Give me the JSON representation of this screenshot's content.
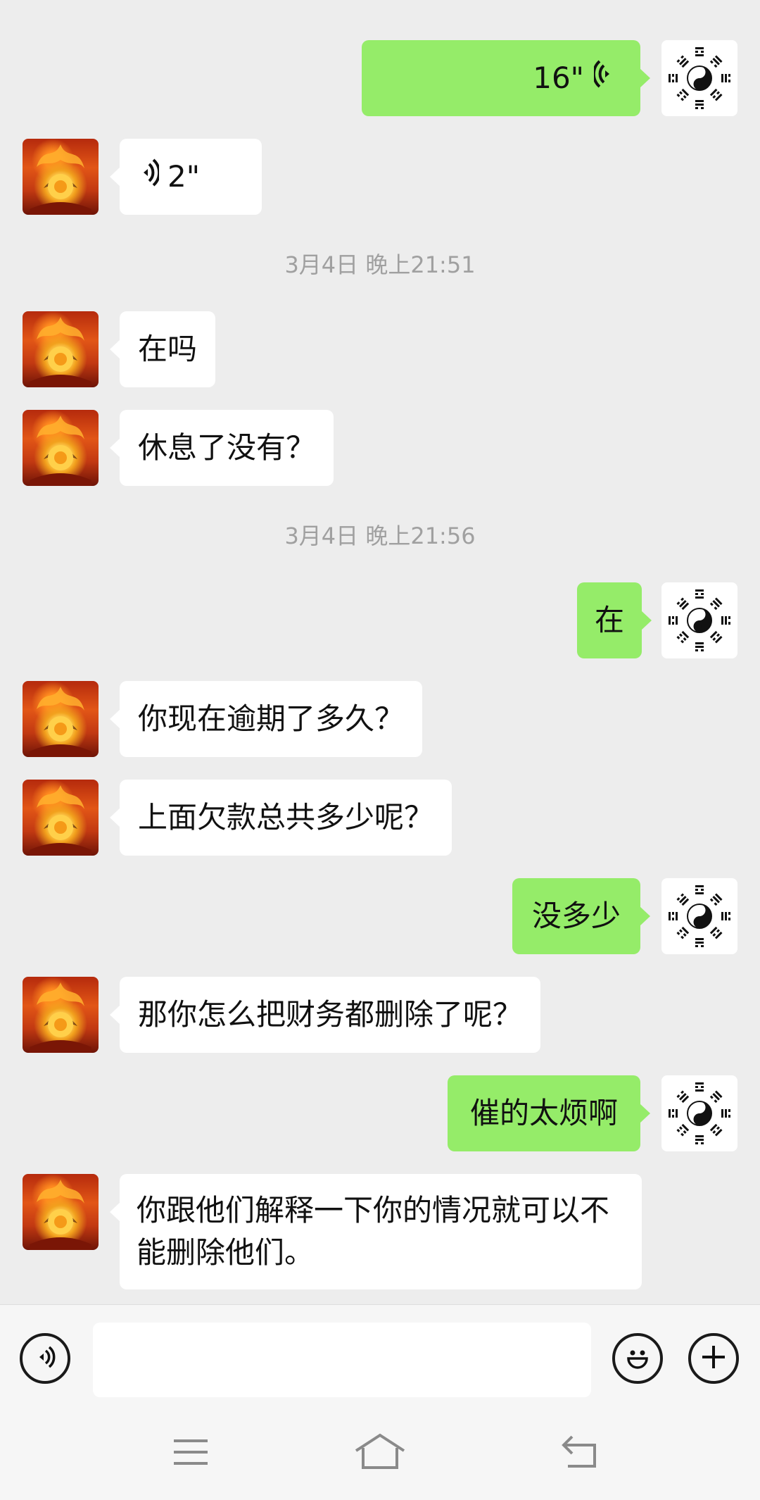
{
  "messages": {
    "m1": {
      "side": "right",
      "type": "voice",
      "duration": "16\""
    },
    "m2": {
      "side": "left",
      "type": "voice",
      "duration": "2\""
    },
    "time1": "3月4日 晚上21:51",
    "m3": "在吗",
    "m4": "休息了没有？",
    "time2": "3月4日 晚上21:56",
    "m5": "在",
    "m6": "你现在逾期了多久？",
    "m7": "上面欠款总共多少呢？",
    "m8": "没多少",
    "m9": "那你怎么把财务都删除了呢？",
    "m10": "催的太烦啊",
    "m11": "你跟他们解释一下你的情况就可以不能删除他们。"
  },
  "colors": {
    "chat_background": "#ededed",
    "sent_bubble": "#95ec69",
    "received_bubble": "#ffffff",
    "timestamp_text": "#a0a0a0"
  },
  "icons": {
    "contact_avatar": "fire-avatar",
    "my_avatar": "yin-yang-bagua-avatar",
    "voice_input": "voice-icon",
    "emoji": "emoji-icon",
    "more": "plus-icon",
    "nav_menu": "menu-icon",
    "nav_home": "home-icon",
    "nav_back": "back-icon"
  },
  "input": {
    "value": ""
  }
}
